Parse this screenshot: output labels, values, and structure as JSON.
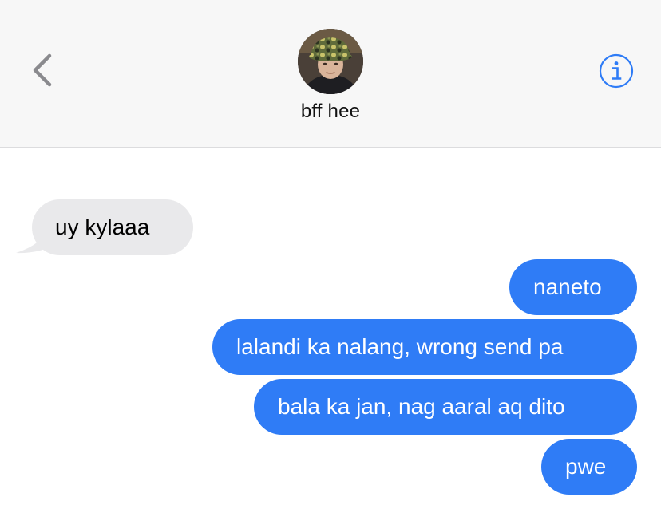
{
  "header": {
    "contact_name": "bff hee",
    "back_icon": "chevron-left-icon",
    "info_icon": "info-circle-icon",
    "accent_color": "#2f7cf6"
  },
  "messages": [
    {
      "direction": "incoming",
      "text": "uy kylaaa"
    },
    {
      "direction": "outgoing",
      "text": "naneto"
    },
    {
      "direction": "outgoing",
      "text": "lalandi ka nalang, wrong send pa"
    },
    {
      "direction": "outgoing",
      "text": "bala ka jan, nag aaral aq dito"
    },
    {
      "direction": "outgoing",
      "text": "pwe"
    }
  ],
  "colors": {
    "incoming_bubble": "#e9e9eb",
    "outgoing_bubble": "#2f7cf6",
    "header_background": "#f7f7f7"
  }
}
